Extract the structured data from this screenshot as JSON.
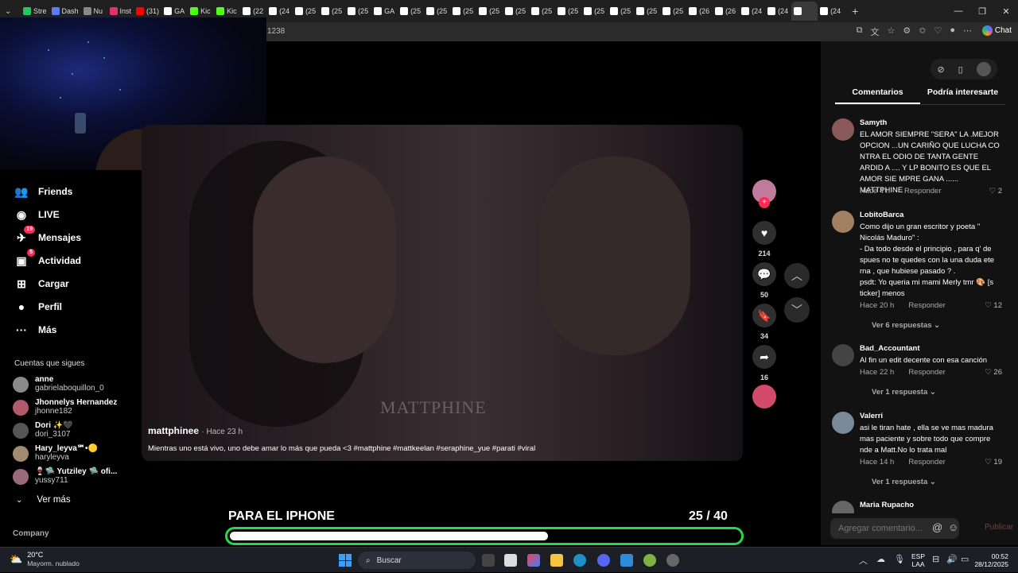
{
  "browser": {
    "tabs": [
      {
        "label": "Stre",
        "color": "#22c55e"
      },
      {
        "label": "Dash",
        "color": "#5b7cf7"
      },
      {
        "label": "Nu",
        "color": "#888888"
      },
      {
        "label": "Inst",
        "color": "#e1306c"
      },
      {
        "label": "(31)",
        "color": "#ff0000"
      },
      {
        "label": "GA",
        "color": "#ffffff"
      },
      {
        "label": "Kic",
        "color": "#53fc18"
      },
      {
        "label": "Kic",
        "color": "#53fc18"
      },
      {
        "label": "(22",
        "color": "#ffffff"
      },
      {
        "label": "(24",
        "color": "#ffffff"
      },
      {
        "label": "(25",
        "color": "#ffffff"
      },
      {
        "label": "(25",
        "color": "#ffffff"
      },
      {
        "label": "(25",
        "color": "#ffffff"
      },
      {
        "label": "GA",
        "color": "#ffffff"
      },
      {
        "label": "(25",
        "color": "#ffffff"
      },
      {
        "label": "(25",
        "color": "#ffffff"
      },
      {
        "label": "(25",
        "color": "#ffffff"
      },
      {
        "label": "(25",
        "color": "#ffffff"
      },
      {
        "label": "(25",
        "color": "#ffffff"
      },
      {
        "label": "(25",
        "color": "#ffffff"
      },
      {
        "label": "(25",
        "color": "#ffffff"
      },
      {
        "label": "(25",
        "color": "#ffffff"
      },
      {
        "label": "(25",
        "color": "#ffffff"
      },
      {
        "label": "(25",
        "color": "#ffffff"
      },
      {
        "label": "(25",
        "color": "#ffffff"
      },
      {
        "label": "(26",
        "color": "#ffffff"
      },
      {
        "label": "(26",
        "color": "#ffffff"
      },
      {
        "label": "(24",
        "color": "#ffffff"
      },
      {
        "label": "(24",
        "color": "#ffffff"
      },
      {
        "label": "",
        "color": "#ffffff"
      },
      {
        "label": "(24",
        "color": "#ffffff"
      }
    ],
    "url_fragment": "1238",
    "chat_label": "Chat"
  },
  "sidebar": {
    "items": [
      {
        "label": "Friends",
        "icon": "friends-icon",
        "badge": ""
      },
      {
        "label": "LIVE",
        "icon": "live-icon",
        "badge": ""
      },
      {
        "label": "Mensajes",
        "icon": "messages-icon",
        "badge": "19"
      },
      {
        "label": "Actividad",
        "icon": "activity-icon",
        "badge": "5"
      },
      {
        "label": "Cargar",
        "icon": "upload-icon",
        "badge": ""
      },
      {
        "label": "Perfil",
        "icon": "profile-icon",
        "badge": ""
      },
      {
        "label": "Más",
        "icon": "more-icon",
        "badge": ""
      }
    ],
    "following_title": "Cuentas que sigues",
    "following": [
      {
        "name": "anne",
        "handle": "gabrielaboquillon_0"
      },
      {
        "name": "Jhonnelys Hernandez",
        "handle": "jhonne182"
      },
      {
        "name": "Dori ✨🖤",
        "handle": "dori_3107"
      },
      {
        "name": "Hary_leyva℠•🟡",
        "handle": "haryleyva"
      },
      {
        "name": "🍷🛸 Yutziley 🛸 ofi...",
        "handle": "yussy711"
      }
    ],
    "see_more": "Ver más",
    "company": "Company"
  },
  "video": {
    "watermark": "MATTPHINE",
    "creator": "mattphinee",
    "posted": "· Hace 23 h",
    "caption": "Mientras uno está vivo, uno debe amar lo más que pueda <3  #mattphine #mattkeelan #seraphine_yue #parati #viral",
    "likes": "214",
    "comments": "50",
    "saves": "34",
    "shares": "16"
  },
  "overlay": {
    "title": "PARA EL IPHONE",
    "count": "25  / 40",
    "progress": 0.625
  },
  "panel": {
    "tab_comments": "Comentarios",
    "tab_interesting": "Podría interesarte",
    "comments": [
      {
        "user": "Samyth",
        "text": "EL AMOR SIEMPRE \"SERA\" LA .MEJOR OPCION ...UN CARIÑO QUE LUCHA CO NTRA EL ODIO DE TANTA GENTE ARDID A .... Y LP BONITO ES QUE EL AMOR SIE MPRE GANA ...... MATTPHINE",
        "time": "Hace 4 h",
        "reply": "Responder",
        "likes": "2",
        "replies": ""
      },
      {
        "user": "LobitoBarca",
        "text": "Como dijo un gran escritor y poeta \" Nicolás Maduro\" :\n- Da todo desde el principio , para q' de spues no te quedes con la una duda ete rna , que hubiese pasado ? .\npsdt: Yo queria mi mami Merly tmr 🎨 [s ticker] menos",
        "time": "Hace 20 h",
        "reply": "Responder",
        "likes": "12",
        "replies": "Ver 6 respuestas ⌄"
      },
      {
        "user": "Bad_Accountant",
        "text": "Al fin un edit decente con esa canción",
        "time": "Hace 22 h",
        "reply": "Responder",
        "likes": "26",
        "replies": "Ver 1 respuesta ⌄"
      },
      {
        "user": "Valerri",
        "text": "asi le tiran hate , ella se ve mas madura mas paciente y sobre todo que compre nde a Matt.No lo trata mal",
        "time": "Hace 14 h",
        "reply": "Responder",
        "likes": "19",
        "replies": "Ver 1 respuesta ⌄"
      },
      {
        "user": "Maria Rupacho",
        "text": "",
        "time": "",
        "reply": "",
        "likes": "",
        "replies": ""
      }
    ],
    "input_placeholder": "Agregar comentario...",
    "publish": "Publicar"
  },
  "taskbar": {
    "weather_temp": "20°C",
    "weather_desc": "Mayorm. nublado",
    "search": "Buscar",
    "lang1": "ESP",
    "lang2": "LAA",
    "time": "00:52",
    "date": "28/12/2025"
  },
  "colors": {
    "accent": "#fe2c55",
    "progress_border": "#25d94a"
  }
}
